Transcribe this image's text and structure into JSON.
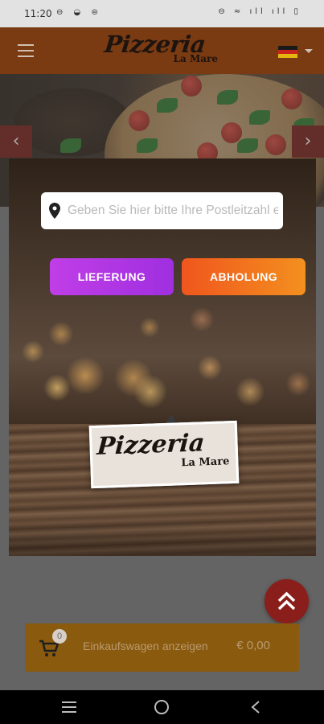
{
  "status_bar": {
    "time": "11:20",
    "left_icons": "⊖ ◒ ⊜",
    "right_icons": "⊖ ≈ ıll ıll ▯"
  },
  "header": {
    "logo_main": "Pizzeria",
    "logo_sub": "La Mare",
    "menu_icon": "hamburger-icon",
    "language_flag": "de-flag"
  },
  "hero": {
    "prev_arrow": "‹",
    "next_arrow": "›"
  },
  "modal": {
    "zip_placeholder": "Geben Sie hier bitte Ihre Postleitzahl ein",
    "delivery_label": "LIEFERUNG",
    "pickup_label": "ABHOLUNG",
    "card_logo_main": "Pizzeria",
    "card_logo_sub": "La Mare"
  },
  "cart": {
    "count": "0",
    "label": "Einkaufswagen anzeigen",
    "total": "€ 0,00"
  },
  "colors": {
    "header": "#7a3a12",
    "delivery": "#b034e6",
    "pickup": "#f27a1e",
    "cart": "#8a5a0e",
    "fab": "#8a1e1a"
  }
}
